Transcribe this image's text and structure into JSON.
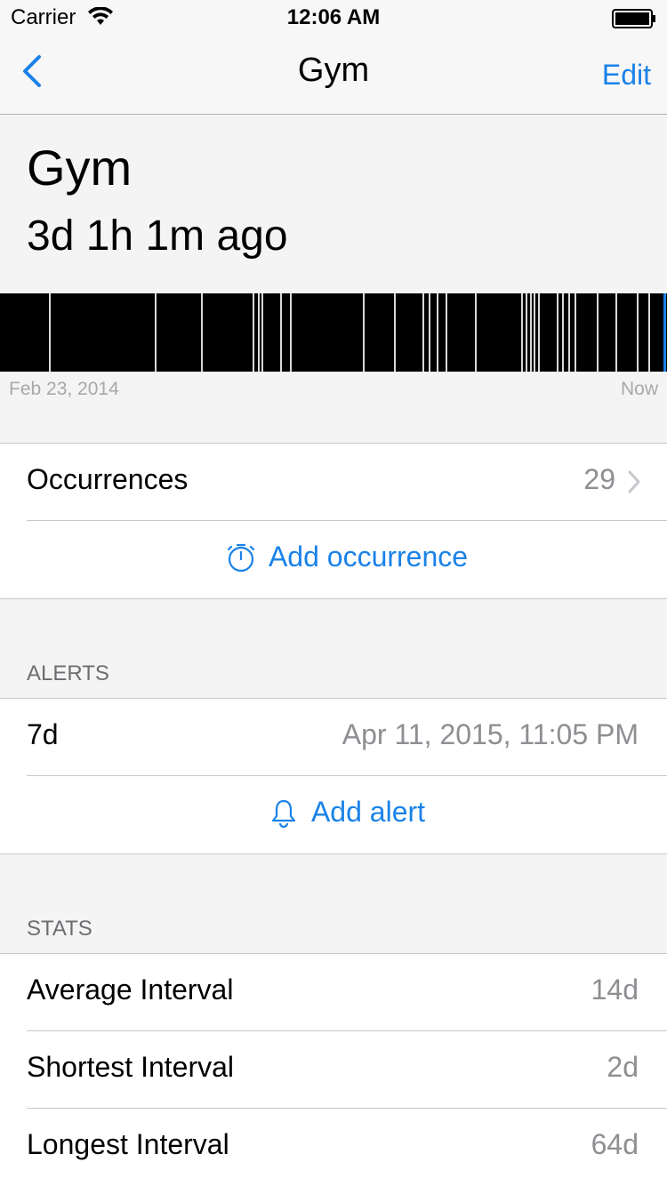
{
  "status_bar": {
    "carrier": "Carrier",
    "time": "12:06 AM"
  },
  "nav": {
    "title": "Gym",
    "edit_label": "Edit"
  },
  "header": {
    "title": "Gym",
    "subtitle": "3d 1h 1m ago"
  },
  "timeline": {
    "start_label": "Feb 23, 2014",
    "end_label": "Now",
    "occurrence_fractions": [
      0.073,
      0.232,
      0.301,
      0.378,
      0.386,
      0.392,
      0.42,
      0.435,
      0.544,
      0.59,
      0.633,
      0.642,
      0.655,
      0.668,
      0.712,
      0.781,
      0.788,
      0.794,
      0.8,
      0.807,
      0.835,
      0.843,
      0.852,
      0.861,
      0.895,
      0.922,
      0.955,
      0.972,
      0.995
    ]
  },
  "occurrences": {
    "label": "Occurrences",
    "count": "29",
    "add_label": "Add occurrence"
  },
  "alerts": {
    "header": "ALERTS",
    "items": [
      {
        "label": "7d",
        "value": "Apr 11, 2015, 11:05 PM"
      }
    ],
    "add_label": "Add alert"
  },
  "stats": {
    "header": "STATS",
    "rows": [
      {
        "label": "Average Interval",
        "value": "14d"
      },
      {
        "label": "Shortest Interval",
        "value": "2d"
      },
      {
        "label": "Longest Interval",
        "value": "64d"
      }
    ]
  },
  "colors": {
    "accent": "#1a82e8",
    "secondary_text": "#8e8e93"
  }
}
